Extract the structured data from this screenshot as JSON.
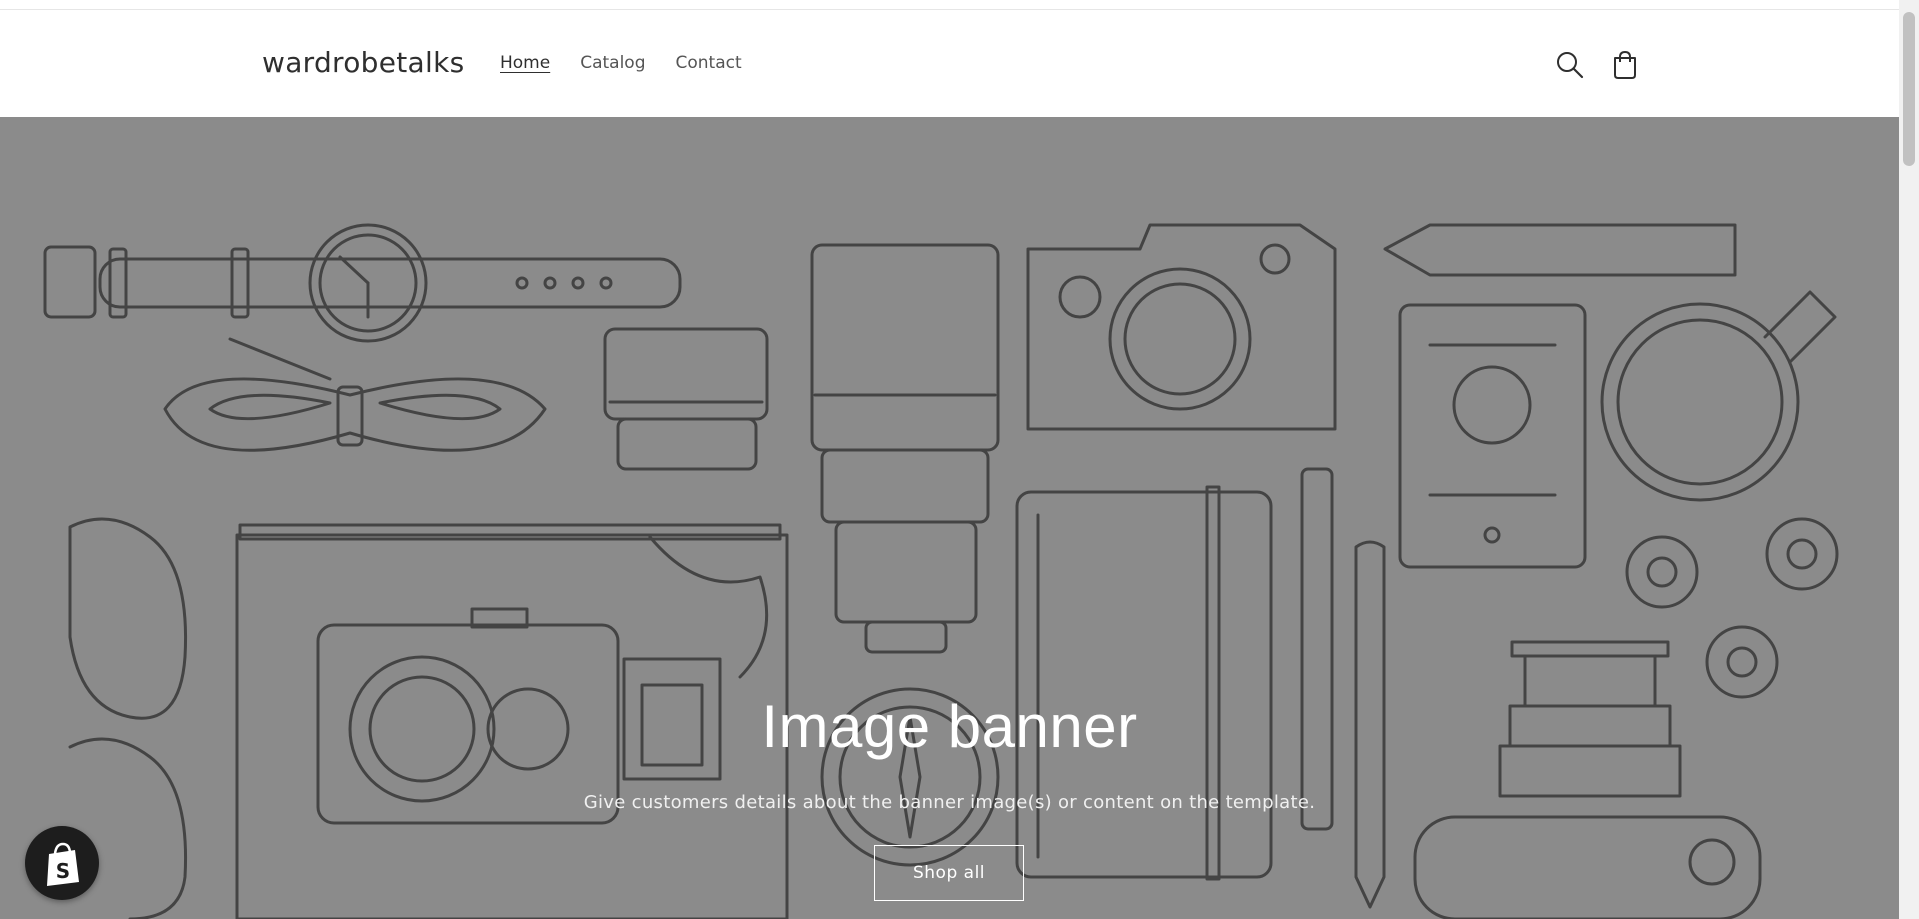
{
  "store": {
    "name": "wardrobetalks"
  },
  "nav": {
    "items": [
      {
        "label": "Home",
        "active": true
      },
      {
        "label": "Catalog",
        "active": false
      },
      {
        "label": "Contact",
        "active": false
      }
    ]
  },
  "header_icons": {
    "search": "search-icon",
    "cart": "cart-icon"
  },
  "banner": {
    "title": "Image banner",
    "subtitle": "Give customers details about the banner image(s) or content on the template.",
    "button_label": "Shop all",
    "background_color": "#8b8b8b"
  },
  "badge": {
    "icon": "shopify-bag-icon"
  }
}
